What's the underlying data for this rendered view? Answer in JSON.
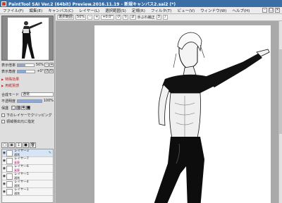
{
  "window": {
    "title": "PaintTool SAI Ver.2 (64bit) Preview.2016.11.19 - 新規キャンバス2.sai2 (*)",
    "controls": [
      "–",
      "□",
      "×"
    ]
  },
  "menu": {
    "items": [
      "ファイル(F)",
      "編集(E)",
      "キャンバス(C)",
      "レイヤー(L)",
      "選択範囲(S)",
      "定規(R)",
      "フィルタ(T)",
      "ビュー(V)",
      "ウィンドウ(W)",
      "ヘルプ(H)"
    ]
  },
  "toolbar": {
    "selection_label": "選択範囲",
    "zoom_value": "50%",
    "angle_value": "+0.0°",
    "stabilizer_label": "手ぶれ補正",
    "stabilizer_value": "3"
  },
  "navigator": {
    "zoom_label": "表示倍率",
    "zoom_value": "50%",
    "zoom_fraction": 0.5,
    "angle_label": "表示角度",
    "angle_value": "+0°",
    "angle_fraction": 0.5
  },
  "panels": {
    "special_effects": "特殊効果",
    "paper_texture": "用紙質感"
  },
  "layer_props": {
    "blend_mode_label": "合成モード",
    "blend_mode_value": "通常",
    "opacity_label": "不透明度",
    "opacity_value": "100%",
    "opacity_fraction": 1.0,
    "protect_label": "保護",
    "clip_label": "下のレイヤーでクリッピング",
    "source_label": "領域検出元に指定"
  },
  "layers": [
    {
      "name": "レイヤー3",
      "mode": "通常",
      "selected": true
    },
    {
      "name": "レイヤー7",
      "mode": "乗算",
      "selected": false
    },
    {
      "name": "レイヤー6",
      "mode": "乗算",
      "selected": false
    },
    {
      "name": "レイヤー5",
      "mode": "通常",
      "selected": false
    },
    {
      "name": "レイヤー4",
      "mode": "通常",
      "selected": false
    },
    {
      "name": "レイヤー1",
      "mode": "通常",
      "selected": false
    }
  ],
  "colors": {
    "title_bg": "#3a6ea5",
    "special_effects_text": "#b22222",
    "selected_layer_bg": "#d6e4f6"
  }
}
